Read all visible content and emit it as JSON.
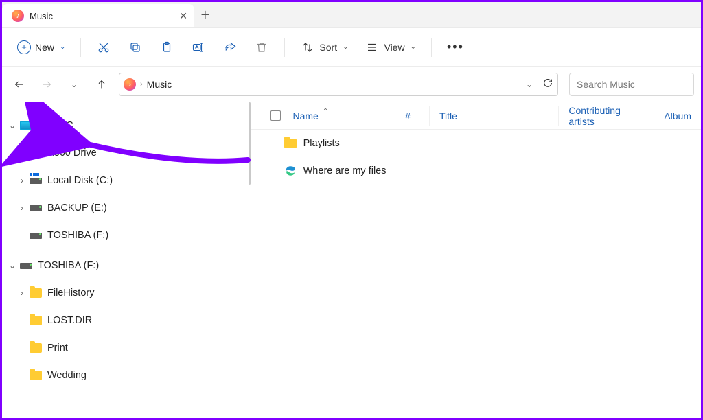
{
  "tab": {
    "title": "Music"
  },
  "toolbar": {
    "new_label": "New",
    "sort_label": "Sort",
    "view_label": "View"
  },
  "address": {
    "crumb": "Music"
  },
  "search": {
    "placeholder": "Search Music"
  },
  "columns": {
    "name": "Name",
    "track": "#",
    "title": "Title",
    "artists": "Contributing artists",
    "album": "Album"
  },
  "files": [
    {
      "name": "Playlists",
      "type": "folder"
    },
    {
      "name": "Where are my files",
      "type": "link"
    }
  ],
  "sidebar": [
    {
      "label": "This PC",
      "level": 1,
      "expander": "open",
      "icon": "monitor"
    },
    {
      "label": "A360 Drive",
      "level": 2,
      "expander": "closed",
      "icon": "cloud"
    },
    {
      "label": "Local Disk (C:)",
      "level": 2,
      "expander": "closed",
      "icon": "disk-c"
    },
    {
      "label": "BACKUP (E:)",
      "level": 2,
      "expander": "closed",
      "icon": "disk"
    },
    {
      "label": "TOSHIBA (F:)",
      "level": 2,
      "expander": "none",
      "icon": "disk"
    },
    {
      "label": "TOSHIBA (F:)",
      "level": 1,
      "expander": "open",
      "icon": "disk"
    },
    {
      "label": "FileHistory",
      "level": 2,
      "expander": "closed",
      "icon": "folder"
    },
    {
      "label": "LOST.DIR",
      "level": 2,
      "expander": "none",
      "icon": "folder"
    },
    {
      "label": "Print",
      "level": 2,
      "expander": "none",
      "icon": "folder"
    },
    {
      "label": "Wedding",
      "level": 2,
      "expander": "none",
      "icon": "folder"
    }
  ]
}
